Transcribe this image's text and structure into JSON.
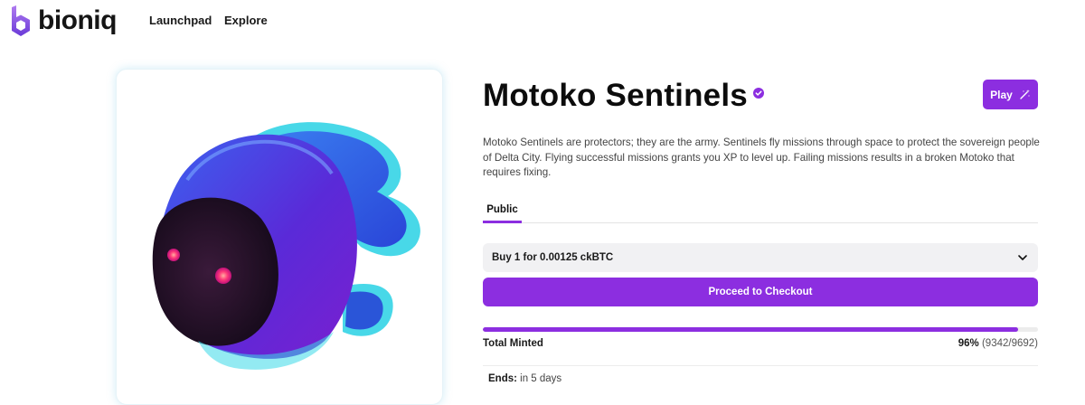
{
  "header": {
    "logo_text": "bioniq",
    "nav": [
      {
        "label": "Launchpad"
      },
      {
        "label": "Explore"
      }
    ]
  },
  "collection": {
    "title": "Motoko Sentinels",
    "verified_icon": "verified-badge-icon",
    "play_label": "Play",
    "play_icon": "magic-wand-icon",
    "description": "Motoko Sentinels are protectors; they are the army. Sentinels fly missions through space to protect the sovereign people of Delta City. Flying successful missions grants you XP to level up. Failing missions results in a broken Motoko that requires fixing."
  },
  "tabs": [
    {
      "label": "Public",
      "active": true
    }
  ],
  "purchase": {
    "selected_option": "Buy 1 for 0.00125 ckBTC",
    "chevron_icon": "chevron-down-icon",
    "checkout_label": "Proceed to Checkout"
  },
  "minting": {
    "label": "Total Minted",
    "percent_text": "96%",
    "count_text": "(9342/9692)",
    "progress_fraction": 0.964
  },
  "ends": {
    "label": "Ends:",
    "value": "in 5 days"
  },
  "colors": {
    "accent": "#8c2ee0",
    "button_text": "#ffffff"
  }
}
